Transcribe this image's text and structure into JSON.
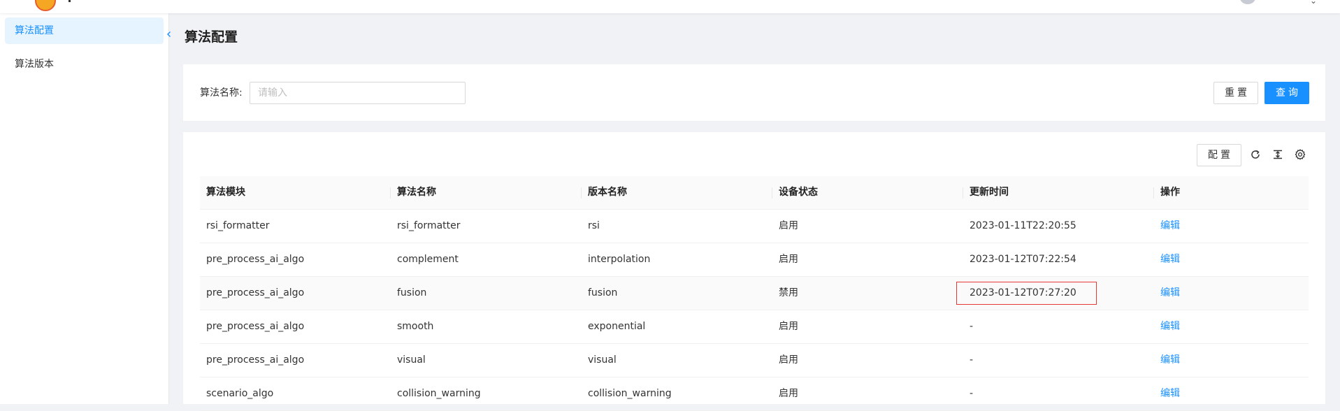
{
  "sidebar": {
    "items": [
      {
        "label": "算法配置",
        "active": true
      },
      {
        "label": "算法版本",
        "active": false
      }
    ],
    "collapse_icon": "chevron-left-icon"
  },
  "page": {
    "title": "算法配置"
  },
  "search": {
    "label": "算法名称:",
    "placeholder": "请输入",
    "value": "",
    "reset_label": "重置",
    "query_label": "查询"
  },
  "toolbar": {
    "config_label": "配置",
    "icons": [
      "refresh-icon",
      "column-height-icon",
      "settings-icon"
    ]
  },
  "table": {
    "columns": [
      "算法模块",
      "算法名称",
      "版本名称",
      "设备状态",
      "更新时间",
      "操作"
    ],
    "rows": [
      {
        "module": "rsi_formatter",
        "name": "rsi_formatter",
        "version": "rsi",
        "status": "启用",
        "updated": "2023-01-11T22:20:55",
        "action": "编辑"
      },
      {
        "module": "pre_process_ai_algo",
        "name": "complement",
        "version": "interpolation",
        "status": "启用",
        "updated": "2023-01-12T07:22:54",
        "action": "编辑"
      },
      {
        "module": "pre_process_ai_algo",
        "name": "fusion",
        "version": "fusion",
        "status": "禁用",
        "updated": "2023-01-12T07:27:20",
        "action": "编辑"
      },
      {
        "module": "pre_process_ai_algo",
        "name": "smooth",
        "version": "exponential",
        "status": "启用",
        "updated": "-",
        "action": "编辑"
      },
      {
        "module": "pre_process_ai_algo",
        "name": "visual",
        "version": "visual",
        "status": "启用",
        "updated": "-",
        "action": "编辑"
      },
      {
        "module": "scenario_algo",
        "name": "collision_warning",
        "version": "collision_warning",
        "status": "启用",
        "updated": "-",
        "action": "编辑"
      }
    ]
  },
  "colors": {
    "primary": "#1890ff",
    "active_menu_bg": "#e6f4ff",
    "highlight_box": "#e53935"
  }
}
